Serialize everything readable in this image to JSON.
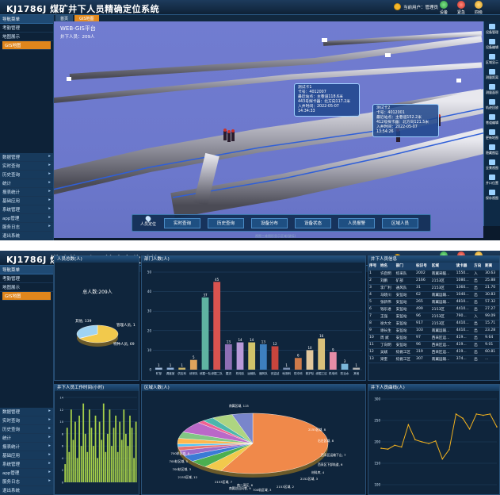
{
  "app": {
    "title": "KJ1786J 煤矿井下人员精确定位系统",
    "user_label": "当前用户：管理员",
    "buttons": [
      {
        "label": "设备",
        "icon": "device-icon",
        "color": "#2b9a3c"
      },
      {
        "label": "紧急",
        "icon": "alarm-icon",
        "color": "#c62b22"
      },
      {
        "label": "四级",
        "icon": "level-icon",
        "color": "#d99a1a"
      }
    ]
  },
  "sidebar": {
    "header": "导航菜单",
    "items": [
      "考勤管理",
      "地图展示",
      "GIS地图"
    ],
    "bottom_items": [
      "数据管理",
      "实时查询",
      "历史查询",
      "统计",
      "报表统计",
      "基础应用",
      "系统管理",
      "app管理",
      "服务日志"
    ],
    "footer": "退出系统"
  },
  "screen1": {
    "tabs": [
      "首页",
      "GIS地图"
    ],
    "platform_title": "WEB-GIS平台",
    "person_count": "井下人员：209人",
    "popups": [
      {
        "lines": [
          "测试卡1",
          "卡号：4012007",
          "最近站点：主巷道118.6米",
          "443号探卡器：北方向117.2米",
          "入井时间：2022-05-07 14:34:33"
        ]
      },
      {
        "lines": [
          "测试卡2",
          "卡号：4012001",
          "最近站点：主巷道152.2米",
          "412号探卡器：北方向121.5米",
          "入井时间：2022-05-07 13:54:26"
        ]
      }
    ],
    "bottom_nav": {
      "location_label": "人员定位",
      "buttons": [
        "实时查询",
        "历史查询",
        "设备分布",
        "设备状态",
        "人员报警",
        "区域人员"
      ]
    },
    "right_tools": [
      "设备管理",
      "设备编辑",
      "区域显示",
      "测量距离",
      "测量面积",
      "轨迹回放",
      "巷道编辑",
      "更新地图",
      "隐藏图层",
      "全景视图",
      "井口位置",
      "保存视图"
    ],
    "tip": "视图三维图形显示区域(鼠标)"
  },
  "screen2": {
    "tabs": [
      "首页"
    ],
    "panels": {
      "total": {
        "title": "人员总数(人)",
        "total_label": "总人数:209人"
      },
      "dept": {
        "title": "部门人数(人)"
      },
      "list": {
        "title": "井下人员信息"
      },
      "hours": {
        "title": "井下人员工作时间(小时)"
      },
      "region": {
        "title": "区域人数(人)"
      },
      "trend": {
        "title": "井下人员曲线(人)"
      }
    },
    "table": {
      "headers": [
        "序号",
        "姓名",
        "部门",
        "标识号",
        "区域",
        "读卡器",
        "方向",
        "距离"
      ],
      "rows": [
        [
          "1",
          "许启明",
          "综采队",
          "2002",
          "南翼采暖...",
          "1550...",
          "入",
          "30.63"
        ],
        [
          "2",
          "刘鹏",
          "矿部",
          "2166",
          "2153区",
          "1080...",
          "出",
          "25.88"
        ],
        [
          "3",
          "李广利",
          "通风队",
          "31",
          "2153区",
          "1360...",
          "出",
          "21.70"
        ],
        [
          "4",
          "马晓川",
          "安监站",
          "62",
          "南翼运输...",
          "1040...",
          "出",
          "30.83"
        ],
        [
          "5",
          "张新伟",
          "安监站",
          "265",
          "南翼运输...",
          "4810...",
          "出",
          "57.32"
        ],
        [
          "6",
          "钱乐进",
          "安监站",
          "499",
          "2153区",
          "4410...",
          "出",
          "27.27"
        ],
        [
          "7",
          "王强",
          "安监站",
          "96",
          "2153区",
          "790...",
          "入",
          "99.09"
        ],
        [
          "8",
          "徐大文",
          "安监站",
          "917",
          "2153区",
          "4410...",
          "出",
          "15.71"
        ],
        [
          "9",
          "谢长生",
          "安监站",
          "103",
          "南翼运输...",
          "4410...",
          "出",
          "23.28"
        ],
        [
          "10",
          "周 斌",
          "安监站",
          "97",
          "西采区运...",
          "419...",
          "出",
          "9.64"
        ],
        [
          "11",
          "丁向明",
          "安监站",
          "96",
          "西采区运...",
          "419...",
          "出",
          "9.01"
        ],
        [
          "12",
          "吴斌",
          "综掘工区",
          "319",
          "西采区运...",
          "419...",
          "出",
          "60.81"
        ],
        [
          "13",
          "梁奎",
          "综掘工区",
          "307",
          "南翼运输...",
          "374...",
          "出",
          "..."
        ]
      ]
    },
    "region_labels": [
      "南翼区域, 115",
      "2153区域, 8",
      "右左区域, 8",
      "西采区运输下山, 7",
      "西采区下部轨道, 6",
      "材料库, 4",
      "2152区域, 3",
      "2153区域, 2",
      "南二采区, 6",
      "2153区域, 7",
      "2153区域, 12",
      "700轨区域, 3",
      "700轨区域, 5",
      "700轨区域, 9",
      "南翼总回风巷, 9",
      "700轨区域, 3"
    ]
  },
  "chart_data": [
    {
      "type": "pie",
      "title": "人员总数(人)",
      "categories": [
        "其他",
        "管理人员",
        "特种人员"
      ],
      "values": [
        139,
        1,
        69
      ]
    },
    {
      "type": "bar",
      "title": "部门人数(人)",
      "categories": [
        "矿部",
        "调度室",
        "供应科",
        "综采队",
        "综掘一队",
        "综掘二队",
        "掘进",
        "机电队",
        "运输队",
        "通风队",
        "安监站",
        "地测科",
        "防冲科",
        "救护队",
        "综掘工区",
        "机电科",
        "防治水",
        "其他"
      ],
      "values": [
        1,
        1,
        1,
        5,
        37,
        45,
        13,
        14,
        14,
        13,
        12,
        1,
        6,
        10,
        16,
        9,
        3,
        1
      ],
      "ylim": [
        0,
        50
      ]
    },
    {
      "type": "bar",
      "title": "井下人员工作时间(小时)",
      "values": [
        3,
        9,
        5,
        12,
        7,
        10,
        4,
        11,
        6,
        13,
        8,
        5,
        12,
        9,
        6,
        11,
        4,
        10,
        7,
        13,
        5,
        8,
        12,
        6,
        9,
        11,
        5,
        10,
        7,
        12,
        8,
        6,
        11,
        9,
        4,
        10
      ],
      "ylim": [
        0,
        14
      ]
    },
    {
      "type": "pie",
      "title": "区域人数(人)",
      "categories": [
        "南翼区域",
        "2153区域",
        "右左区域",
        "西采区运输下山",
        "西采区下部轨道",
        "材料库",
        "2152区域",
        "南二采区",
        "2153区域",
        "2153区域",
        "700轨区域",
        "700轨区域",
        "700轨区域",
        "南翼总回风巷"
      ],
      "values": [
        115,
        8,
        8,
        7,
        6,
        4,
        3,
        6,
        7,
        12,
        3,
        5,
        9,
        9
      ]
    },
    {
      "type": "line",
      "title": "井下人员曲线(人)",
      "values": [
        185,
        183,
        192,
        188,
        240,
        205,
        200,
        196,
        202,
        160,
        182,
        265,
        255,
        230,
        265,
        262,
        265,
        235
      ],
      "ylim": [
        100,
        300
      ],
      "yticks": [
        100,
        150,
        200,
        250,
        300
      ]
    }
  ]
}
